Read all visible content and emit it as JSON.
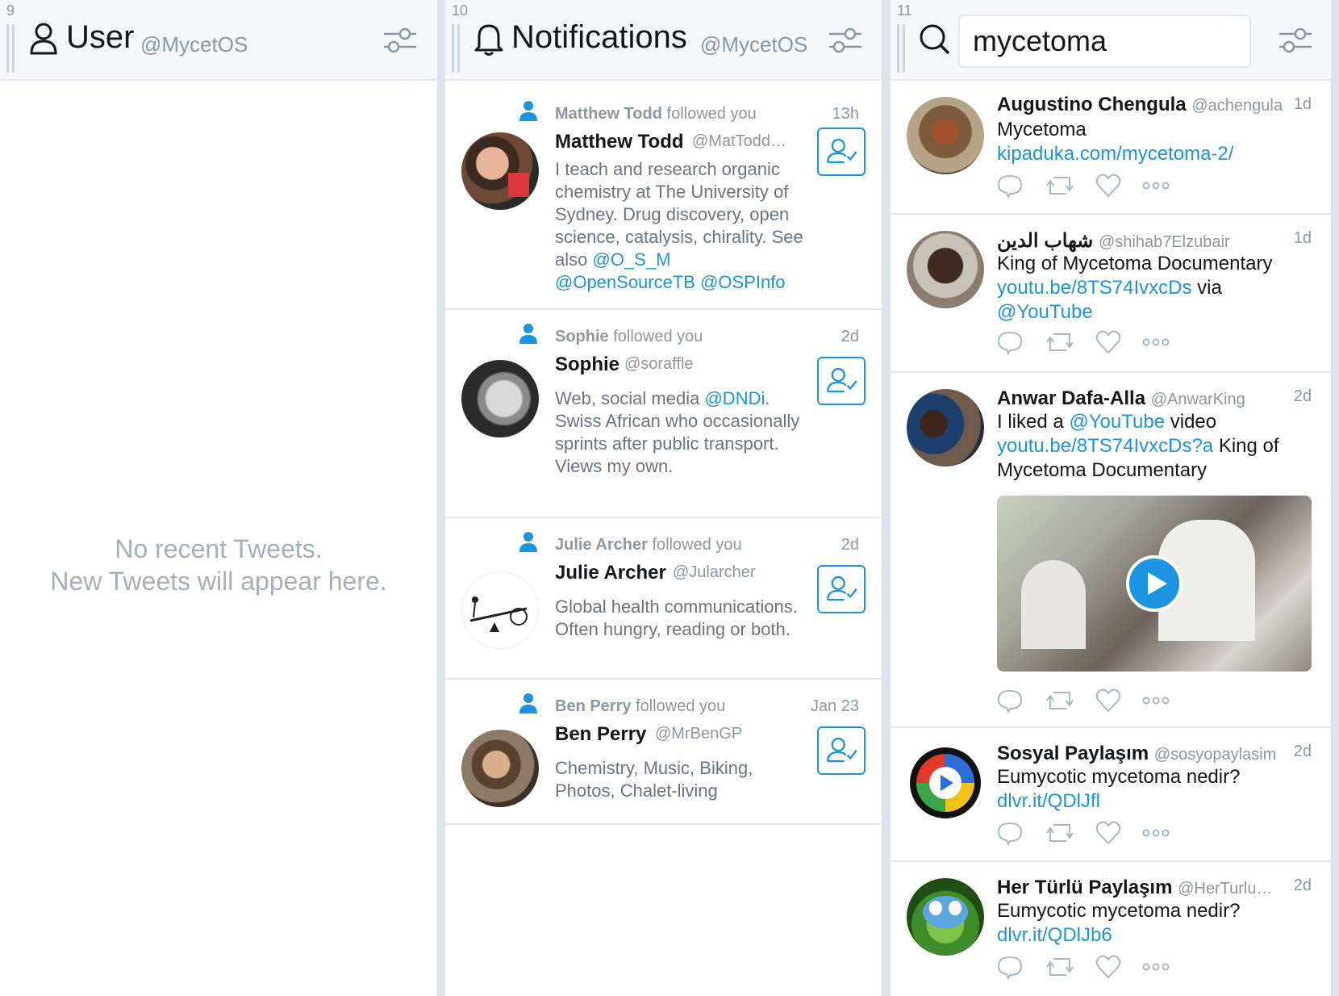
{
  "columns": {
    "user": {
      "number": "9",
      "title": "User",
      "handle": "@MycetOS",
      "empty_line1": "No recent Tweets.",
      "empty_line2": "New Tweets will appear here."
    },
    "notifications": {
      "number": "10",
      "title": "Notifications",
      "handle": "@MycetOS",
      "items": [
        {
          "actor": "Matthew Todd",
          "action": "followed you",
          "time": "13h",
          "name": "Matthew Todd",
          "handle": "@MatTodd…",
          "bio_text": "I teach and research organic chemistry at The University of Sydney. Drug discovery, open science, catalysis, chirality. See also",
          "bio_links": "@O_S_M @OpenSourceTB @OSPInfo"
        },
        {
          "actor": "Sophie",
          "action": "followed you",
          "time": "2d",
          "name": "Sophie",
          "handle": "@soraffle",
          "bio_pre": "Web, social media",
          "bio_link": "@DNDi",
          "bio_post": ". Swiss African who occasionally sprints after public transport. Views my own."
        },
        {
          "actor": "Julie Archer",
          "action": "followed you",
          "time": "2d",
          "name": "Julie Archer",
          "handle": "@Jularcher",
          "bio": "Global health communications. Often hungry, reading or both."
        },
        {
          "actor": "Ben Perry",
          "action": "followed you",
          "time": "Jan 23",
          "name": "Ben Perry",
          "handle": "@MrBenGP",
          "bio": "Chemistry, Music, Biking, Photos, Chalet-living"
        }
      ]
    },
    "search": {
      "number": "11",
      "query": "mycetoma",
      "tweets": [
        {
          "name": "Augustino Chengula",
          "handle": "@achengula",
          "time": "1d",
          "text": "Mycetoma",
          "link": "kipaduka.com/mycetoma-2/"
        },
        {
          "name": "شهاب الدين",
          "handle": "@shihab7Elzubair",
          "time": "1d",
          "text": "King of Mycetoma Documentary",
          "link": "youtu.be/8TS74IvxcDs",
          "text_after": "via",
          "link2": "@YouTube"
        },
        {
          "name": "Anwar Dafa-Alla",
          "handle": "@AnwarKing",
          "time": "2d",
          "text": "I liked a",
          "link": "@YouTube",
          "text_after": "video",
          "link2": "youtu.be/8TS74IvxcDs?a",
          "text_end": "King of Mycetoma Documentary"
        },
        {
          "name": "Sosyal Paylaşım",
          "handle": "@sosyopaylasim",
          "time": "2d",
          "text": "Eumycotic mycetoma nedir?",
          "link": "dlvr.it/QDlJfl"
        },
        {
          "name": "Her Türlü Paylaşım",
          "handle": "@HerTurlu…",
          "time": "2d",
          "text": "Eumycotic mycetoma nedir?",
          "link": "dlvr.it/QDlJb6"
        }
      ]
    }
  },
  "colors": {
    "accent": "#1b95e0",
    "muted": "#8899a6",
    "border": "#e1e8ed"
  }
}
